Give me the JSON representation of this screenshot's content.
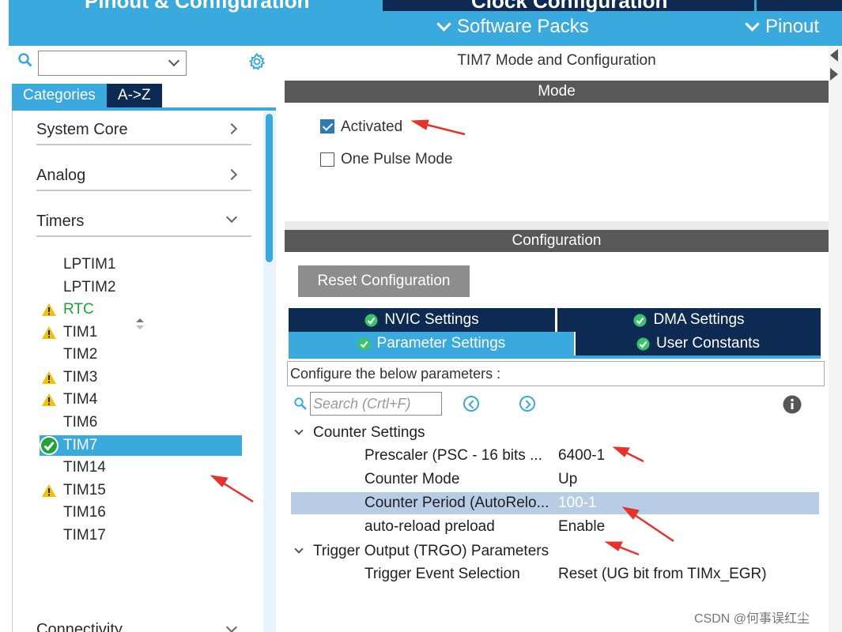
{
  "header": {
    "tabs": [
      {
        "label": "Pinout & Configuration"
      },
      {
        "label": "Clock Configuration"
      }
    ],
    "menus": [
      {
        "label": "Software Packs"
      },
      {
        "label": "Pinout"
      }
    ]
  },
  "left_panel": {
    "search": {
      "value": ""
    },
    "category_tabs": [
      {
        "label": "Categories",
        "active": true
      },
      {
        "label": "A->Z",
        "active": false
      }
    ],
    "categories": [
      {
        "label": "System Core",
        "expanded": false
      },
      {
        "label": "Analog",
        "expanded": false
      },
      {
        "label": "Timers",
        "expanded": true
      },
      {
        "label": "Connectivity",
        "expanded": true
      }
    ],
    "timers": [
      {
        "label": "LPTIM1",
        "status": "none"
      },
      {
        "label": "LPTIM2",
        "status": "none"
      },
      {
        "label": "RTC",
        "status": "warning"
      },
      {
        "label": "TIM1",
        "status": "warning"
      },
      {
        "label": "TIM2",
        "status": "none"
      },
      {
        "label": "TIM3",
        "status": "warning"
      },
      {
        "label": "TIM4",
        "status": "warning"
      },
      {
        "label": "TIM6",
        "status": "none"
      },
      {
        "label": "TIM7",
        "status": "ok",
        "selected": true
      },
      {
        "label": "TIM14",
        "status": "none"
      },
      {
        "label": "TIM15",
        "status": "warning"
      },
      {
        "label": "TIM16",
        "status": "none"
      },
      {
        "label": "TIM17",
        "status": "none"
      }
    ]
  },
  "right_panel": {
    "title": "TIM7 Mode and Configuration",
    "mode_bar": "Mode",
    "mode_options": [
      {
        "label": "Activated",
        "checked": true
      },
      {
        "label": "One Pulse Mode",
        "checked": false
      }
    ],
    "config_bar": "Configuration",
    "reset_button": "Reset Configuration",
    "settings_tabs": [
      {
        "label": "NVIC Settings",
        "active": false
      },
      {
        "label": "DMA Settings",
        "active": false
      },
      {
        "label": "Parameter Settings",
        "active": true
      },
      {
        "label": "User Constants",
        "active": false
      }
    ],
    "param_hint": "Configure the below parameters :",
    "param_search_placeholder": "Search (Crtl+F)",
    "groups": [
      {
        "label": "Counter Settings",
        "params": [
          {
            "name": "Prescaler (PSC - 16 bits ...",
            "value": "6400-1"
          },
          {
            "name": "Counter Mode",
            "value": "Up"
          },
          {
            "name": "Counter Period (AutoRelo...",
            "value": "100-1",
            "highlighted": true
          },
          {
            "name": "auto-reload preload",
            "value": "Enable"
          }
        ]
      },
      {
        "label": "Trigger Output (TRGO) Parameters",
        "params": [
          {
            "name": "Trigger Event Selection",
            "value": "Reset (UG bit from TIMx_EGR)"
          }
        ]
      }
    ]
  },
  "watermark": "CSDN @何事误红尘",
  "colors": {
    "accent": "#3aa9dd",
    "navy": "#0d2b52",
    "bar_gray": "#585858",
    "warning": "#f2c200",
    "ok": "#22a33a",
    "annotation_arrow": "#e8312a"
  }
}
